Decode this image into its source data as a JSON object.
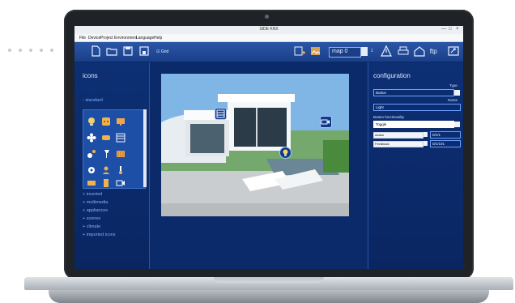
{
  "app": {
    "title": "SIDE KNX",
    "window_controls": [
      "—",
      "□",
      "×"
    ],
    "menu": [
      "File",
      "Device",
      "Project",
      "Environment",
      "Language",
      "Help"
    ]
  },
  "toolbar": {
    "checkbox_label": "Grid",
    "map_select": "map 0",
    "map_count": "1"
  },
  "left_panel": {
    "title": "icons",
    "standard_label": "- standard",
    "categories": [
      "+ inverted",
      "+ multimedia",
      "+ appliances",
      "+ scenes",
      "+ climate",
      "+ imported icons"
    ]
  },
  "right_panel": {
    "title": "configuration",
    "type_label": "Type",
    "type_value": "Button",
    "name_label": "Name",
    "name_value": "Light",
    "button_functionality_label": "Button functionality",
    "button_functionality_value": "Toggle",
    "action_label": "Action",
    "action_value": "0/1/1",
    "feedback_label": "Feedback",
    "feedback_value": "0/1/101"
  },
  "colors": {
    "app_bg": "#0c2a67",
    "accent_blue": "#2a56a8",
    "highlight": "#6ea1ff",
    "text_light": "#dbe8ff"
  }
}
